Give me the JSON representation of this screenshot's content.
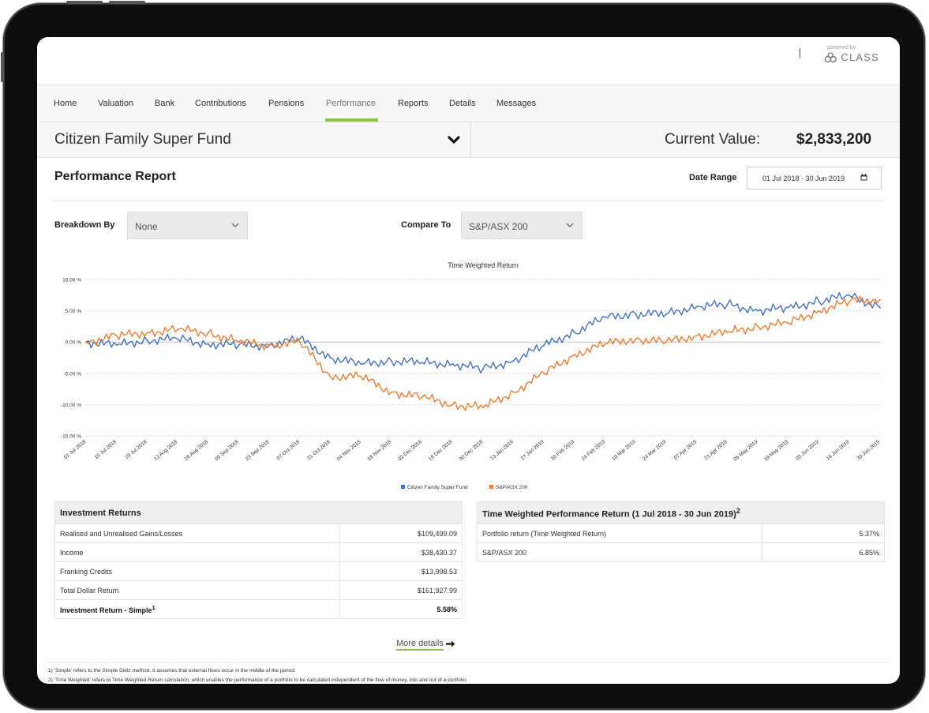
{
  "brand": {
    "powered_by": "powered by",
    "name": "CLASS"
  },
  "nav": {
    "items": [
      "Home",
      "Valuation",
      "Bank",
      "Contributions",
      "Pensions",
      "Performance",
      "Reports",
      "Details",
      "Messages"
    ],
    "active": "Performance"
  },
  "fund": {
    "name": "Citizen Family Super Fund",
    "current_value_label": "Current Value:",
    "current_value": "$2,833,200"
  },
  "report": {
    "title": "Performance Report",
    "date_range_label": "Date Range",
    "date_range_value": "01 Jul 2018 - 30 Jun 2019",
    "breakdown_label": "Breakdown By",
    "breakdown_value": "None",
    "compare_label": "Compare To",
    "compare_value": "S&P/ASX 200"
  },
  "chart_data": {
    "type": "line",
    "title": "Time Weighted Return",
    "xlabel": "",
    "ylabel": "",
    "ylim": [
      -15,
      10
    ],
    "yticks": [
      "10.00 %",
      "5.00 %",
      "0.00 %",
      "-5.00 %",
      "-10.00 %",
      "-15.00 %"
    ],
    "x": [
      "01 Jul 2018",
      "15 Jul 2018",
      "29 Jul 2018",
      "12 Aug 2018",
      "26 Aug 2018",
      "09 Sep 2018",
      "23 Sep 2018",
      "07 Oct 2018",
      "21 Oct 2018",
      "04 Nov 2018",
      "18 Nov 2018",
      "02 Dec 2018",
      "16 Dec 2018",
      "30 Dec 2018",
      "13 Jan 2019",
      "27 Jan 2019",
      "10 Feb 2019",
      "24 Feb 2019",
      "10 Mar 2019",
      "24 Mar 2019",
      "07 Apr 2019",
      "21 Apr 2019",
      "05 May 2019",
      "19 May 2019",
      "02 Jun 2019",
      "16 Jun 2019",
      "30 Jun 2019"
    ],
    "grid": true,
    "legend": "bottom",
    "series": [
      {
        "name": "Citizen Family Super Fund",
        "color": "#4472c4",
        "values": [
          0.0,
          -0.5,
          0.3,
          0.5,
          -0.3,
          -0.5,
          -0.5,
          0.5,
          -2.5,
          -3.5,
          -3.0,
          -3.3,
          -3.5,
          -4.3,
          -3.0,
          -0.5,
          1.5,
          4.0,
          4.5,
          4.5,
          5.7,
          6.0,
          5.0,
          5.5,
          6.5,
          7.5,
          5.5
        ]
      },
      {
        "name": "S&P/ASX 200",
        "color": "#ed7d31",
        "values": [
          0.0,
          1.0,
          1.5,
          2.0,
          1.5,
          0.0,
          -0.5,
          0.0,
          -5.5,
          -5.5,
          -8.0,
          -8.8,
          -10.0,
          -10.5,
          -8.0,
          -5.0,
          -2.0,
          -0.3,
          0.5,
          0.0,
          1.0,
          1.5,
          2.5,
          3.0,
          5.0,
          6.5,
          6.8
        ]
      }
    ]
  },
  "investment_returns": {
    "title": "Investment Returns",
    "rows": [
      {
        "label": "Realised and Unrealised Gains/Losses",
        "value": "$109,499.09"
      },
      {
        "label": "Income",
        "value": "$38,430.37"
      },
      {
        "label": "Franking Credits",
        "value": "$13,998.53"
      },
      {
        "label": "Total Dollar Return",
        "value": "$161,927.99"
      }
    ],
    "total_label": "Investment Return - Simple",
    "total_sup": "1",
    "total_value": "5.58%"
  },
  "twr_table": {
    "title": "Time Weighted Performance Return (1 Jul 2018 - 30 Jun 2019)",
    "title_sup": "2",
    "rows": [
      {
        "label": "Portfolio return (Time Weighted Return)",
        "value": "5.37%"
      },
      {
        "label": "S&P/ASX 200",
        "value": "6.85%"
      }
    ]
  },
  "more_details": "More details",
  "footnotes": [
    "1) ‘Simple’ refers to the Simple Dietz method. It assumes that external flows occur in the middle of the period.",
    "2) ‘Time Weighted’ refers to Time Weighted Return calculation, which enables the performance of a portfolio to be calculated independent of the flow of money, into and out of a portfolio."
  ]
}
